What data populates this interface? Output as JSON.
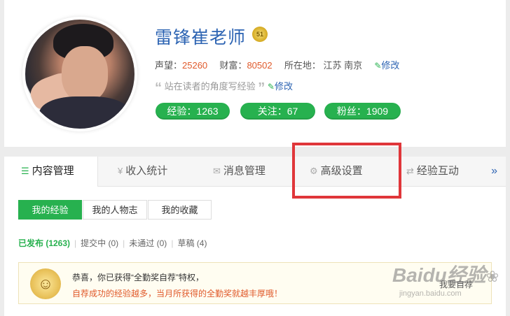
{
  "profile": {
    "name": "雷锋崔老师",
    "level": "51",
    "reputation_label": "声望：",
    "reputation": "25260",
    "wealth_label": "财富：",
    "wealth": "80502",
    "location_label": "所在地：",
    "location": "江苏 南京",
    "edit_label": "修改",
    "motto": "站在读者的角度写经验",
    "motto_edit_label": "修改",
    "exp_pill": "经验：1263",
    "follow_pill": "关注：67",
    "fans_pill": "粉丝：1909"
  },
  "tabs": [
    {
      "label": "内容管理",
      "icon": "list-icon"
    },
    {
      "label": "收入统计",
      "icon": "yen-icon"
    },
    {
      "label": "消息管理",
      "icon": "mail-icon"
    },
    {
      "label": "高级设置",
      "icon": "gear-icon"
    },
    {
      "label": "经验互动",
      "icon": "exchange-icon"
    }
  ],
  "tabs_more": "»",
  "subtabs": [
    "我的经验",
    "我的人物志",
    "我的收藏"
  ],
  "filters": {
    "published": "已发布 (1263)",
    "submitting": "提交中 (0)",
    "rejected": "未通过 (0)",
    "draft": "草稿 (4)"
  },
  "notice": {
    "line1": "恭喜，你已获得“全勤奖自荐”特权，",
    "line2": "自荐成功的经验越多，当月所获得的全勤奖就越丰厚哦！",
    "button": "我要自荐"
  },
  "watermark": {
    "brand": "Baidu经验",
    "url": "jingyan.baidu.com"
  },
  "colors": {
    "accent_green": "#27b14f",
    "link_blue": "#2d64b3",
    "number_orange": "#e05a2b",
    "highlight_red": "#e0363a"
  }
}
